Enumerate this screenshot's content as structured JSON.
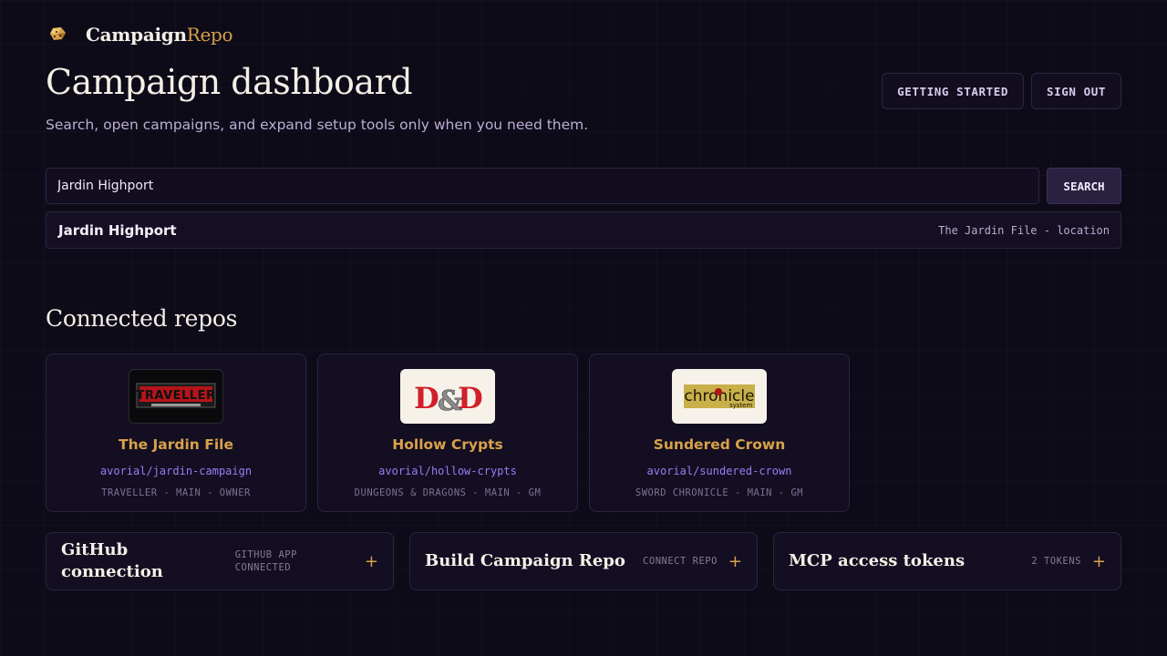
{
  "brand": {
    "name_main": "Campaign",
    "name_accent": "Repo",
    "icon": "dice-icon"
  },
  "header": {
    "title": "Campaign dashboard",
    "subtitle": "Search, open campaigns, and expand setup tools only when you need them.",
    "actions": {
      "getting_started": "GETTING STARTED",
      "sign_out": "SIGN OUT"
    }
  },
  "search": {
    "value": "Jardin Highport",
    "button": "SEARCH"
  },
  "result": {
    "name": "Jardin Highport",
    "meta": "The Jardin File - location"
  },
  "repos": {
    "heading": "Connected repos",
    "items": [
      {
        "name": "The Jardin File",
        "path": "avorial/jardin-campaign",
        "tags": "TRAVELLER - MAIN - OWNER",
        "logo_text": "TRAVELLER"
      },
      {
        "name": "Hollow Crypts",
        "path": "avorial/hollow-crypts",
        "tags": "DUNGEONS & DRAGONS - MAIN - GM",
        "logo_text": "D&D"
      },
      {
        "name": "Sundered Crown",
        "path": "avorial/sundered-crown",
        "tags": "SWORD CHRONICLE - MAIN - GM",
        "logo_text": "chronicle"
      }
    ]
  },
  "panels": [
    {
      "title_line1": "GitHub",
      "title_line2": "connection",
      "meta_line1": "GITHUB APP",
      "meta_line2": "CONNECTED",
      "icon": "plus-icon"
    },
    {
      "title": "Build Campaign Repo",
      "meta": "CONNECT REPO",
      "icon": "plus-icon"
    },
    {
      "title": "MCP access tokens",
      "meta": "2 TOKENS",
      "icon": "plus-icon"
    }
  ],
  "colors": {
    "accent": "#d9a24a",
    "link": "#9b7cf2",
    "background": "#0e0b19"
  }
}
